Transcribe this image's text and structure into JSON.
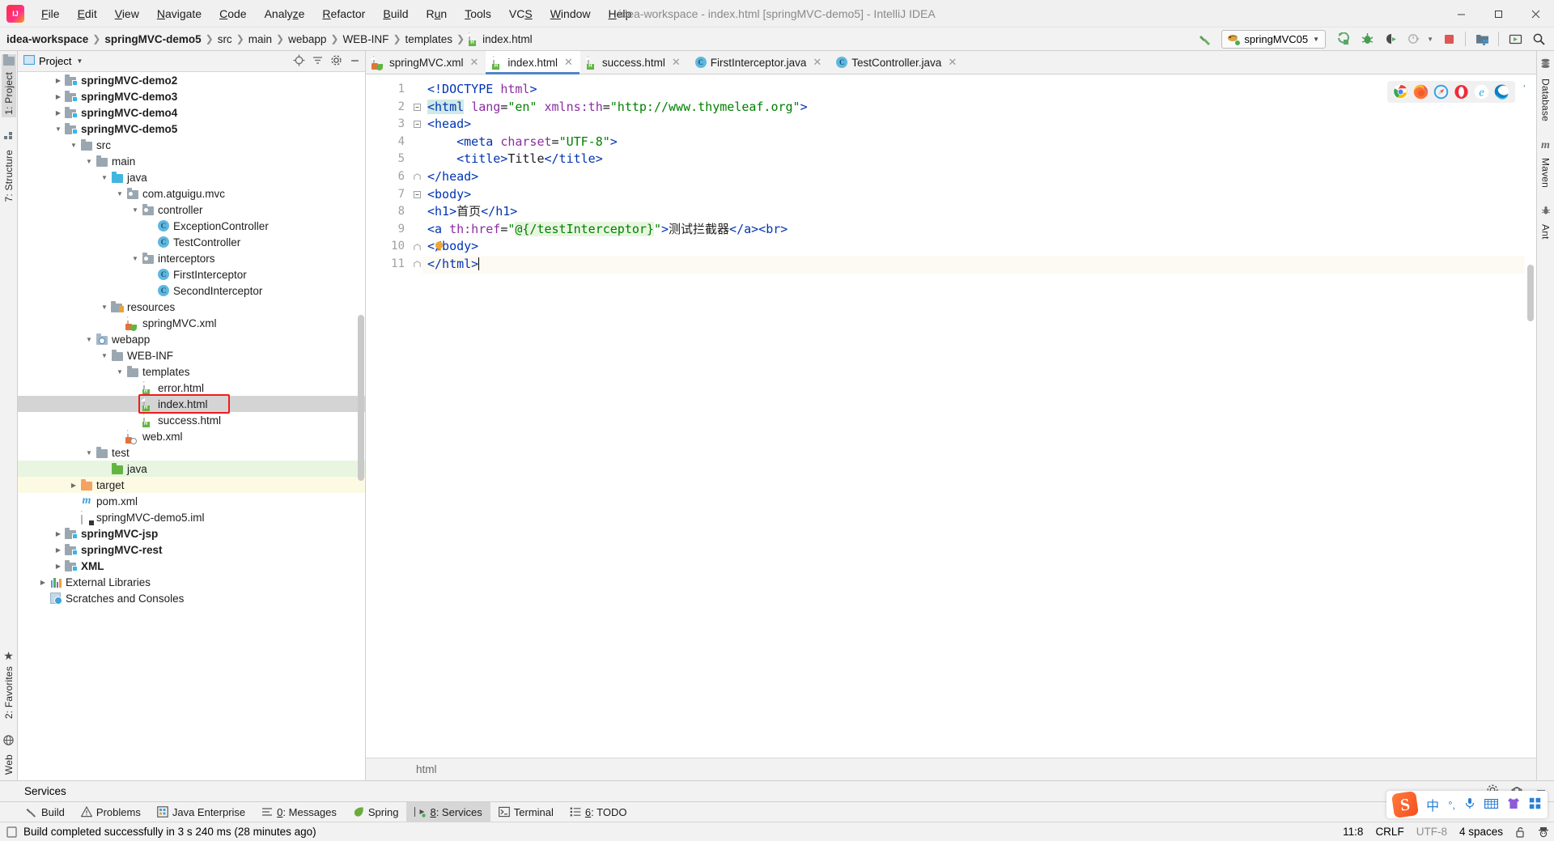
{
  "window": {
    "title": "idea-workspace - index.html [springMVC-demo5] - IntelliJ IDEA",
    "minimize": "─",
    "maximize": "☐",
    "close": "✕"
  },
  "menu": [
    {
      "label": "File"
    },
    {
      "label": "Edit"
    },
    {
      "label": "View"
    },
    {
      "label": "Navigate"
    },
    {
      "label": "Code"
    },
    {
      "label": "Analyze"
    },
    {
      "label": "Refactor"
    },
    {
      "label": "Build"
    },
    {
      "label": "Run"
    },
    {
      "label": "Tools"
    },
    {
      "label": "VCS"
    },
    {
      "label": "Window"
    },
    {
      "label": "Help"
    }
  ],
  "navbar": {
    "crumbs": [
      {
        "label": "idea-workspace",
        "bold": true
      },
      {
        "label": "springMVC-demo5",
        "bold": true
      },
      {
        "label": "src",
        "bold": false
      },
      {
        "label": "main",
        "bold": false
      },
      {
        "label": "webapp",
        "bold": false
      },
      {
        "label": "WEB-INF",
        "bold": false
      },
      {
        "label": "templates",
        "bold": false
      },
      {
        "label": "index.html",
        "bold": false,
        "icon": "html-file-icon"
      }
    ],
    "run_config": "springMVC05",
    "toolbar_icons": [
      "build-hammer-icon",
      "run-icon",
      "debug-icon",
      "run-with-coverage-icon",
      "profiler-icon",
      "stop-icon",
      "project-structure-icon",
      "update-app-icon",
      "search-everywhere-icon"
    ]
  },
  "left_rail": {
    "top": [
      {
        "label": "1: Project",
        "accel": "1",
        "active": false
      },
      {
        "label": "",
        "icon": "folder-icon",
        "active": true
      },
      {
        "label": "7: Structure",
        "accel": "7",
        "active": false
      },
      {
        "label": "",
        "icon": "modules-icon",
        "active": false
      }
    ],
    "bottom": [
      {
        "label": "2: Favorites",
        "accel": "2"
      },
      {
        "label": "",
        "icon": "star-icon"
      },
      {
        "label": "Web",
        "accel": ""
      },
      {
        "label": "",
        "icon": "globe-icon"
      }
    ]
  },
  "right_rail": [
    {
      "label": "Database",
      "icon": "database-icon"
    },
    {
      "label": "Maven",
      "icon": "maven-m-icon"
    },
    {
      "label": "Ant",
      "icon": "ant-bug-icon"
    }
  ],
  "project_panel": {
    "title": "Project",
    "header_icons": [
      "target-icon",
      "collapse-all-icon",
      "settings-gear-icon",
      "hide-icon"
    ],
    "tree": [
      {
        "depth": 1,
        "label": "springMVC-demo2",
        "bold": true,
        "arrow": "collapsed",
        "icon": "module-folder-icon"
      },
      {
        "depth": 1,
        "label": "springMVC-demo3",
        "bold": true,
        "arrow": "collapsed",
        "icon": "module-folder-icon"
      },
      {
        "depth": 1,
        "label": "springMVC-demo4",
        "bold": true,
        "arrow": "collapsed",
        "icon": "module-folder-icon"
      },
      {
        "depth": 1,
        "label": "springMVC-demo5",
        "bold": true,
        "arrow": "expanded",
        "icon": "module-folder-icon"
      },
      {
        "depth": 2,
        "label": "src",
        "bold": false,
        "arrow": "expanded",
        "icon": "folder-icon"
      },
      {
        "depth": 3,
        "label": "main",
        "bold": false,
        "arrow": "expanded",
        "icon": "folder-icon"
      },
      {
        "depth": 4,
        "label": "java",
        "bold": false,
        "arrow": "expanded",
        "icon": "source-folder-icon"
      },
      {
        "depth": 5,
        "label": "com.atguigu.mvc",
        "bold": false,
        "arrow": "expanded",
        "icon": "package-icon"
      },
      {
        "depth": 6,
        "label": "controller",
        "bold": false,
        "arrow": "expanded",
        "icon": "package-icon"
      },
      {
        "depth": 7,
        "label": "ExceptionController",
        "bold": false,
        "arrow": "none",
        "icon": "java-class-icon"
      },
      {
        "depth": 7,
        "label": "TestController",
        "bold": false,
        "arrow": "none",
        "icon": "java-class-icon"
      },
      {
        "depth": 6,
        "label": "interceptors",
        "bold": false,
        "arrow": "expanded",
        "icon": "package-icon"
      },
      {
        "depth": 7,
        "label": "FirstInterceptor",
        "bold": false,
        "arrow": "none",
        "icon": "java-class-icon"
      },
      {
        "depth": 7,
        "label": "SecondInterceptor",
        "bold": false,
        "arrow": "none",
        "icon": "java-class-icon"
      },
      {
        "depth": 4,
        "label": "resources",
        "bold": false,
        "arrow": "expanded",
        "icon": "resources-folder-icon"
      },
      {
        "depth": 5,
        "label": "springMVC.xml",
        "bold": false,
        "arrow": "none",
        "icon": "spring-xml-icon"
      },
      {
        "depth": 3,
        "label": "webapp",
        "bold": false,
        "arrow": "expanded",
        "icon": "web-folder-icon"
      },
      {
        "depth": 4,
        "label": "WEB-INF",
        "bold": false,
        "arrow": "expanded",
        "icon": "folder-icon"
      },
      {
        "depth": 5,
        "label": "templates",
        "bold": false,
        "arrow": "expanded",
        "icon": "folder-icon"
      },
      {
        "depth": 6,
        "label": "error.html",
        "bold": false,
        "arrow": "none",
        "icon": "html-file-icon"
      },
      {
        "depth": 6,
        "label": "index.html",
        "bold": false,
        "arrow": "none",
        "icon": "html-file-icon",
        "selected": true,
        "highlighted": true
      },
      {
        "depth": 6,
        "label": "success.html",
        "bold": false,
        "arrow": "none",
        "icon": "html-file-icon"
      },
      {
        "depth": 5,
        "label": "web.xml",
        "bold": false,
        "arrow": "none",
        "icon": "web-xml-icon"
      },
      {
        "depth": 3,
        "label": "test",
        "bold": false,
        "arrow": "expanded",
        "icon": "folder-icon"
      },
      {
        "depth": 4,
        "label": "java",
        "bold": false,
        "arrow": "none",
        "icon": "test-source-folder-icon",
        "row_bg": "green"
      },
      {
        "depth": 2,
        "label": "target",
        "bold": false,
        "arrow": "collapsed",
        "icon": "excluded-folder-icon",
        "row_bg": "yellow"
      },
      {
        "depth": 2,
        "label": "pom.xml",
        "bold": false,
        "arrow": "none",
        "icon": "maven-pom-icon"
      },
      {
        "depth": 2,
        "label": "springMVC-demo5.iml",
        "bold": false,
        "arrow": "none",
        "icon": "iml-file-icon"
      },
      {
        "depth": 1,
        "label": "springMVC-jsp",
        "bold": true,
        "arrow": "collapsed",
        "icon": "module-folder-icon"
      },
      {
        "depth": 1,
        "label": "springMVC-rest",
        "bold": true,
        "arrow": "collapsed",
        "icon": "module-folder-icon"
      },
      {
        "depth": 1,
        "label": "XML",
        "bold": true,
        "arrow": "collapsed",
        "icon": "module-folder-icon"
      },
      {
        "depth": 0,
        "label": "External Libraries",
        "bold": false,
        "arrow": "collapsed",
        "icon": "external-libraries-icon"
      },
      {
        "depth": 0,
        "label": "Scratches and Consoles",
        "bold": false,
        "arrow": "none",
        "icon": "scratches-icon"
      }
    ]
  },
  "editor": {
    "tabs": [
      {
        "label": "springMVC.xml",
        "icon": "spring-xml-icon",
        "active": false
      },
      {
        "label": "index.html",
        "icon": "html-file-icon",
        "active": true
      },
      {
        "label": "success.html",
        "icon": "html-file-icon",
        "active": false
      },
      {
        "label": "FirstInterceptor.java",
        "icon": "java-class-icon",
        "active": false
      },
      {
        "label": "TestController.java",
        "icon": "java-class-icon",
        "active": false
      }
    ],
    "close_glyph": "✕",
    "line_numbers": [
      "1",
      "2",
      "3",
      "4",
      "5",
      "6",
      "7",
      "8",
      "9",
      "10",
      "11"
    ],
    "lines": [
      {
        "n": 1,
        "fold": "",
        "tokens": [
          {
            "t": "<!DOCTYPE ",
            "c": "tag"
          },
          {
            "t": "html",
            "c": "attr"
          },
          {
            "t": ">",
            "c": "tag"
          }
        ]
      },
      {
        "n": 2,
        "fold": "-",
        "tokens": [
          {
            "t": "<html",
            "c": "tag",
            "hl": "cyan"
          },
          {
            "t": " ",
            "c": "plain"
          },
          {
            "t": "lang",
            "c": "attr"
          },
          {
            "t": "=",
            "c": "plain"
          },
          {
            "t": "\"en\"",
            "c": "val"
          },
          {
            "t": " ",
            "c": "plain"
          },
          {
            "t": "xmlns:th",
            "c": "attr"
          },
          {
            "t": "=",
            "c": "plain"
          },
          {
            "t": "\"http://www.thymeleaf.org\"",
            "c": "val"
          },
          {
            "t": ">",
            "c": "tag"
          }
        ]
      },
      {
        "n": 3,
        "fold": "-",
        "tokens": [
          {
            "t": "<head>",
            "c": "tag"
          }
        ]
      },
      {
        "n": 4,
        "fold": "",
        "tokens": [
          {
            "t": "    <meta ",
            "c": "tag"
          },
          {
            "t": "charset",
            "c": "attr"
          },
          {
            "t": "=",
            "c": "plain"
          },
          {
            "t": "\"UTF-8\"",
            "c": "val"
          },
          {
            "t": ">",
            "c": "tag"
          }
        ]
      },
      {
        "n": 5,
        "fold": "",
        "tokens": [
          {
            "t": "    <title>",
            "c": "tag"
          },
          {
            "t": "Title",
            "c": "plain"
          },
          {
            "t": "</title>",
            "c": "tag"
          }
        ]
      },
      {
        "n": 6,
        "fold": "^",
        "tokens": [
          {
            "t": "</head>",
            "c": "tag"
          }
        ]
      },
      {
        "n": 7,
        "fold": "-",
        "tokens": [
          {
            "t": "<body>",
            "c": "tag"
          }
        ]
      },
      {
        "n": 8,
        "fold": "",
        "tokens": [
          {
            "t": "<h1>",
            "c": "tag"
          },
          {
            "t": "首页",
            "c": "plain"
          },
          {
            "t": "</h1>",
            "c": "tag"
          }
        ]
      },
      {
        "n": 9,
        "fold": "",
        "tokens": [
          {
            "t": "<a ",
            "c": "tag"
          },
          {
            "t": "th:href",
            "c": "attr"
          },
          {
            "t": "=",
            "c": "plain"
          },
          {
            "t": "\"",
            "c": "val"
          },
          {
            "t": "@{/testInterceptor}",
            "c": "val",
            "hl": "green"
          },
          {
            "t": "\"",
            "c": "val"
          },
          {
            "t": ">",
            "c": "tag"
          },
          {
            "t": "测试拦截器",
            "c": "plain"
          },
          {
            "t": "</a>",
            "c": "tag"
          },
          {
            "t": "<br>",
            "c": "tag"
          }
        ]
      },
      {
        "n": 10,
        "fold": "^",
        "tokens": [
          {
            "t": "</body>",
            "c": "tag",
            "bulb": true
          }
        ]
      },
      {
        "n": 11,
        "fold": "^",
        "tokens": [
          {
            "t": "</html>",
            "c": "tag",
            "caret": true
          }
        ],
        "current": true
      }
    ],
    "browsers": [
      "chrome-icon",
      "firefox-icon",
      "safari-icon",
      "opera-icon",
      "internet-explorer-icon",
      "edge-icon"
    ],
    "inspection_status": "ok-check-icon",
    "breadcrumb": "html"
  },
  "services_strip": {
    "label": "Services",
    "right_icons": [
      "settings-gear-icon",
      "hide-icon",
      "minimize-icon"
    ]
  },
  "tool_windows": [
    {
      "label": "Build",
      "icon": "build-hammer-icon",
      "accel": "",
      "active": false
    },
    {
      "label": "Problems",
      "icon": "problems-warning-icon",
      "accel": "",
      "active": false
    },
    {
      "label": "Java Enterprise",
      "icon": "java-enterprise-icon",
      "accel": "",
      "active": false
    },
    {
      "label": "0: Messages",
      "icon": "messages-icon",
      "accel": "0",
      "active": false
    },
    {
      "label": "Spring",
      "icon": "spring-leaf-icon",
      "accel": "",
      "active": false
    },
    {
      "label": "8: Services",
      "icon": "services-icon",
      "accel": "8",
      "active": true
    },
    {
      "label": "Terminal",
      "icon": "terminal-icon",
      "accel": "",
      "active": false
    },
    {
      "label": "6: TODO",
      "icon": "todo-icon",
      "accel": "6",
      "active": false
    }
  ],
  "statusbar": {
    "message": "Build completed successfully in 3 s 240 ms (28 minutes ago)",
    "message_icon": "event-log-icon",
    "caret_position": "11:8",
    "line_separator": "CRLF",
    "encoding": "UTF-8",
    "indent": "4 spaces",
    "lock_icon": "unlocked-padlock-icon",
    "inspector_icon": "hector-inspector-icon"
  },
  "ime_tray": {
    "logo": "sogou-logo-icon",
    "items": [
      "chinese-mode-icon",
      "punctuation-icon",
      "microphone-icon",
      "soft-keyboard-icon",
      "skin-icon",
      "toolbox-icon"
    ],
    "chinese_glyph": "中",
    "punct_glyph": "°,"
  },
  "colors": {
    "accent_blue": "#4f87c7",
    "tag_blue": "#0033b3",
    "attr_purple": "#8b2da1",
    "string_green": "#008000",
    "highlight_red": "#f21b1b",
    "selection_gray": "#d4d4d4",
    "test_green": "#e8f5e0",
    "excluded_yellow": "#fdfae3"
  }
}
